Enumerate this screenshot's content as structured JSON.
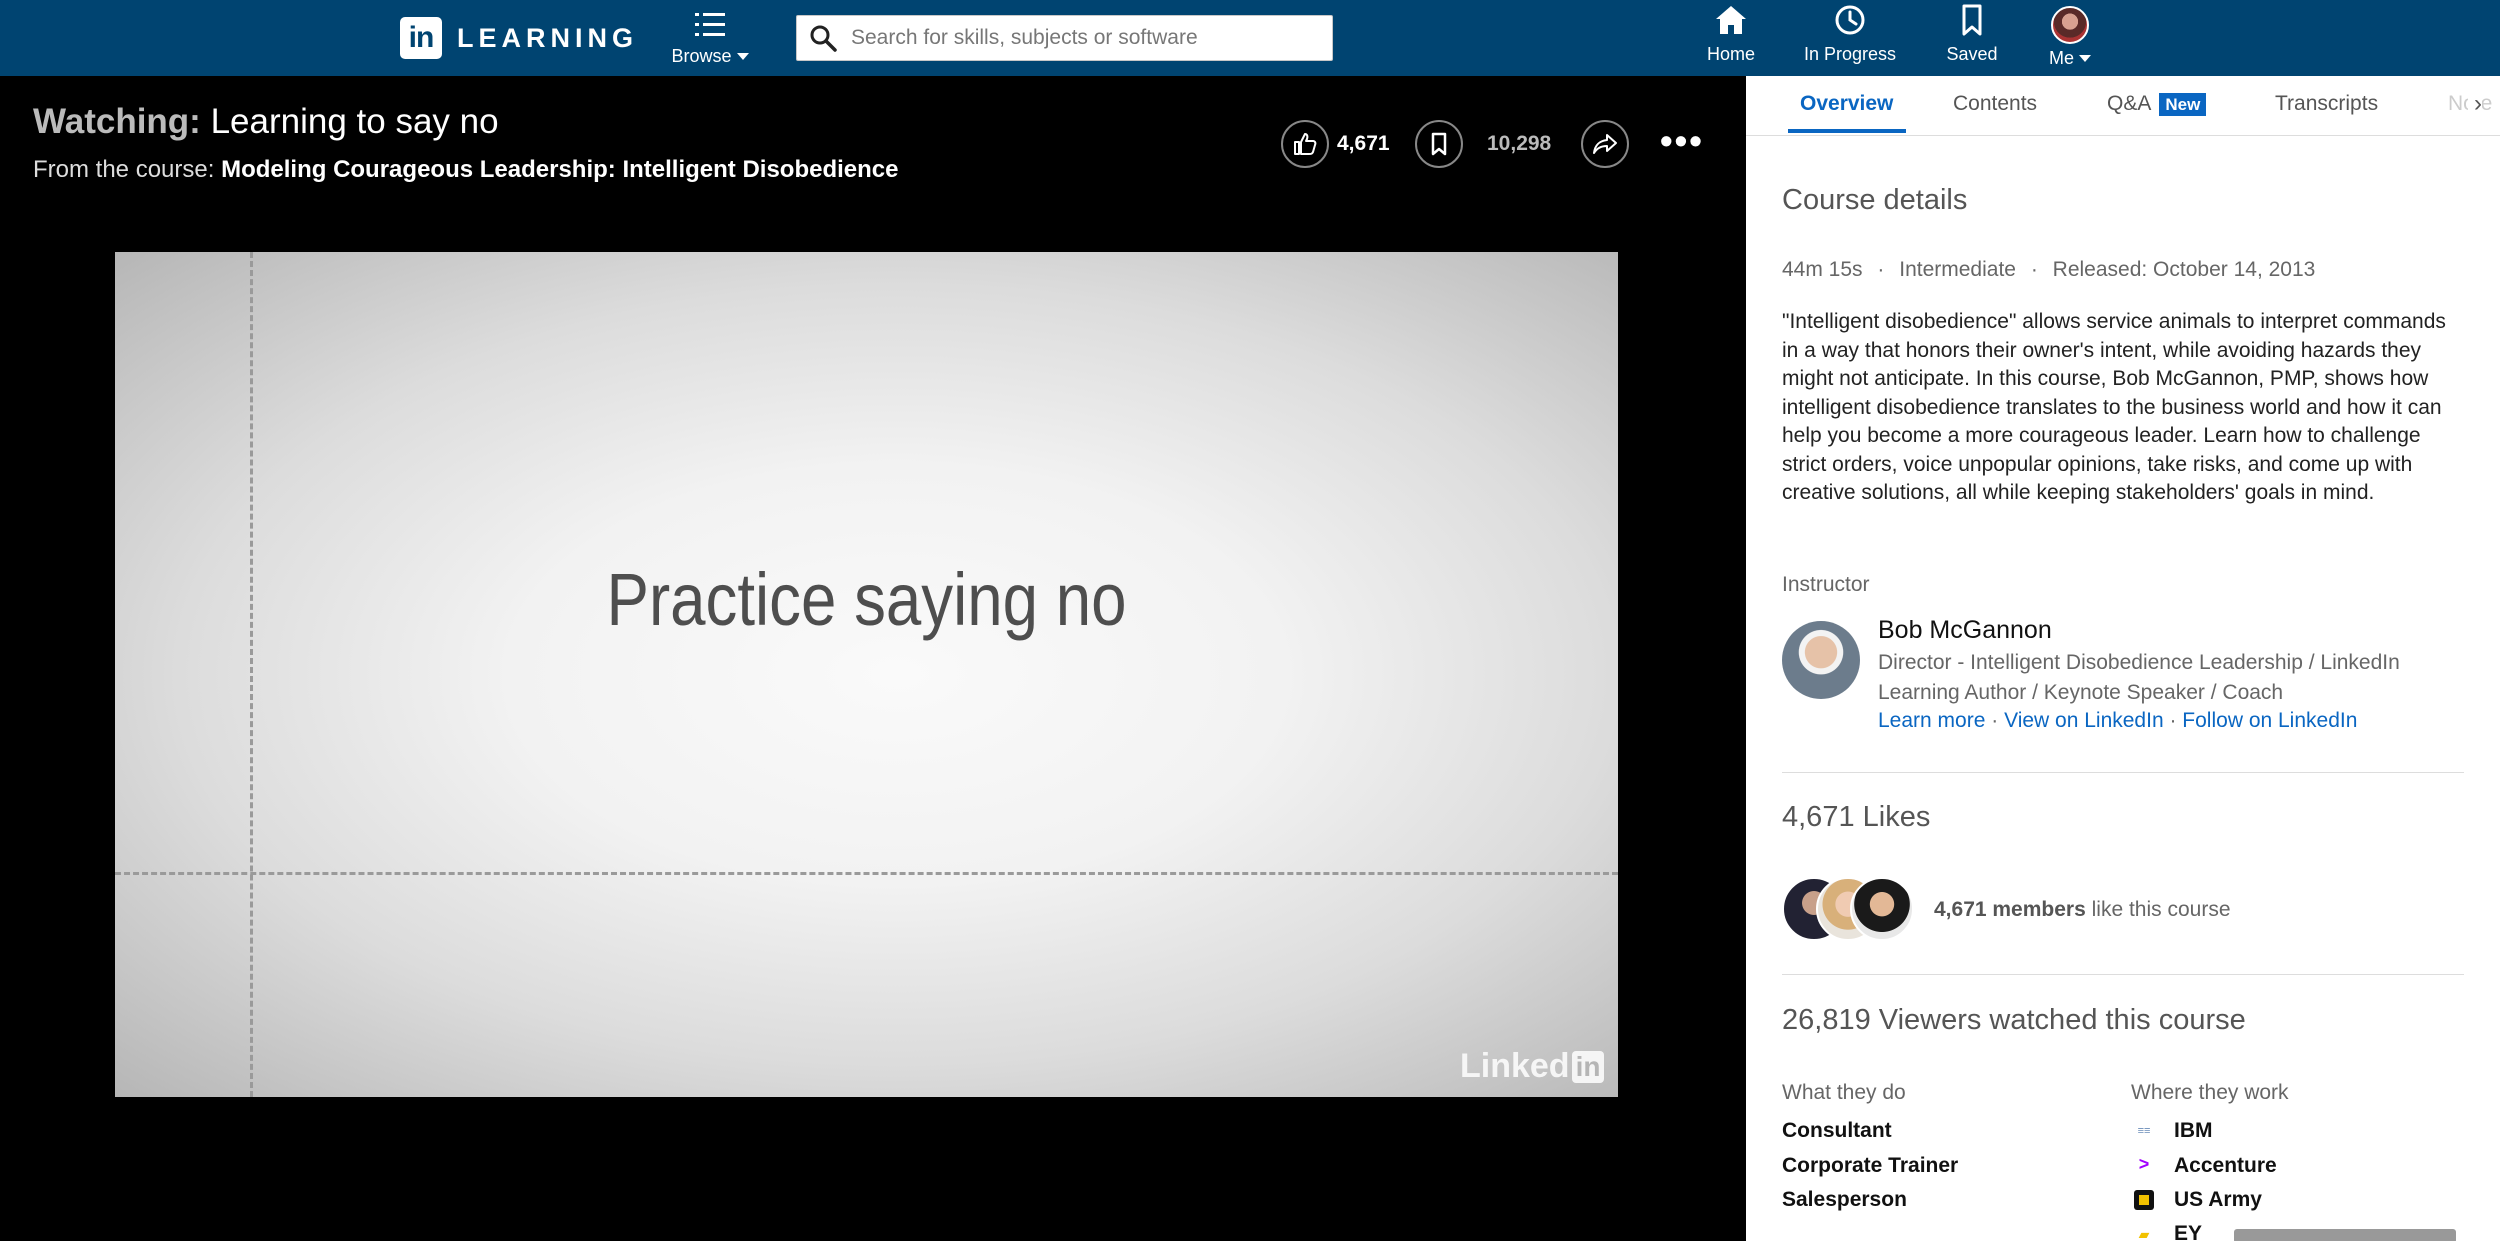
{
  "topnav": {
    "logo_letters": "in",
    "logo_text": "LEARNING",
    "browse_label": "Browse",
    "search_placeholder": "Search for skills, subjects or software",
    "home_label": "Home",
    "in_progress_label": "In Progress",
    "saved_label": "Saved",
    "me_label": "Me"
  },
  "video": {
    "watching_prefix": "Watching:",
    "watching_title": "Learning to say no",
    "from_prefix": "From the course:",
    "course_name": "Modeling Courageous Leadership: Intelligent Disobedience",
    "likes_count": "4,671",
    "saved_count": "10,298",
    "more_label": "•••",
    "slide_text": "Practice saying no",
    "watermark": "Linked",
    "watermark_in": "in"
  },
  "panel": {
    "tabs": {
      "overview": "Overview",
      "contents": "Contents",
      "qa": "Q&A",
      "qa_badge": "New",
      "transcripts": "Transcripts",
      "notes_cut": "Note"
    },
    "course_details_title": "Course details",
    "meta": {
      "duration": "44m 15s",
      "level": "Intermediate",
      "released": "Released: October 14, 2013",
      "sep": "·"
    },
    "description": "\"Intelligent disobedience\" allows service animals to interpret commands in a way that honors their owner's intent, while avoiding hazards they might not anticipate. In this course, Bob McGannon, PMP, shows how intelligent disobedience translates to the business world and how it can help you become a more courageous leader. Learn how to challenge strict orders, voice unpopular opinions, take risks, and come up with creative solutions, all while keeping stakeholders' goals in mind.",
    "instructor_label": "Instructor",
    "instructor": {
      "name": "Bob McGannon",
      "role": "Director - Intelligent Disobedience Leadership / LinkedIn Learning Author / Keynote Speaker / Coach",
      "learn_more": "Learn more",
      "view_linkedin": "View on LinkedIn",
      "follow_linkedin": "Follow on LinkedIn",
      "dot": " · "
    },
    "likes_title": "4,671 Likes",
    "likes_members_bold": "4,671 members",
    "likes_members_rest": " like this course",
    "viewers_title": "26,819 Viewers watched this course",
    "what_they_do_label": "What they do",
    "where_they_work_label": "Where they work",
    "roles": [
      "Consultant",
      "Corporate Trainer",
      "Salesperson"
    ],
    "companies": [
      "IBM",
      "Accenture",
      "US Army",
      "EY"
    ]
  },
  "colors": {
    "nav_bg": "#004471",
    "accent_blue": "#0a66c2",
    "accenture_purple": "#a100ff"
  }
}
